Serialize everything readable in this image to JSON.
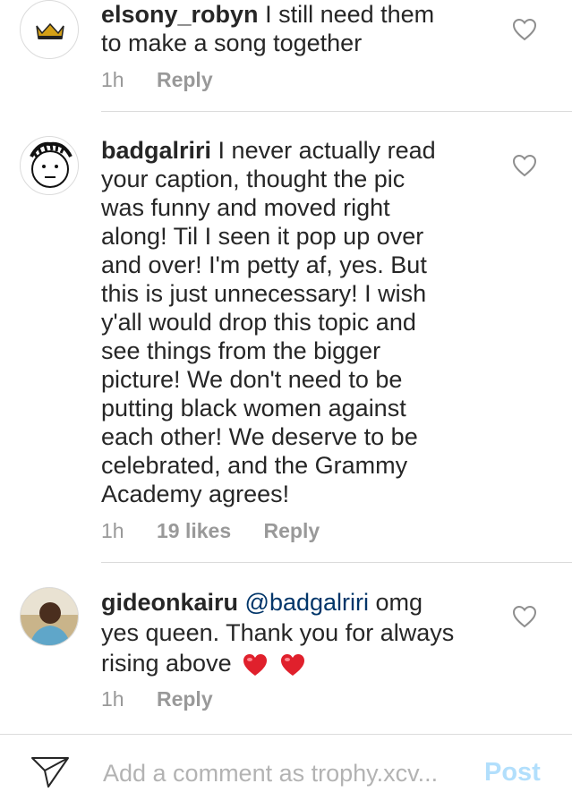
{
  "comments": [
    {
      "username": "elsony_robyn",
      "mention": "",
      "text": "I still need them to make a song together",
      "text_lines": [
        "I still need them",
        "to make a song together"
      ],
      "time": "1h",
      "likes": "",
      "reply_label": "Reply"
    },
    {
      "username": "badgalriri",
      "mention": "",
      "text_lines": [
        "I never actually read",
        "your caption, thought the pic",
        "was funny and moved right",
        "along! Til I seen it pop up over",
        "and over! I'm petty af, yes. But",
        "this is just unnecessary! I wish",
        "y'all would drop this topic and",
        "see things from the bigger",
        "picture! We don't need to be",
        "putting black women against",
        "each other! We deserve to be",
        "celebrated, and the Grammy",
        "Academy agrees!"
      ],
      "time": "1h",
      "likes": "19 likes",
      "reply_label": "Reply"
    },
    {
      "username": "gideonkairu",
      "mention": "@badgalriri",
      "text_lines": [
        "omg",
        "yes queen. Thank you for always",
        "rising above"
      ],
      "emoji": "❤️❤️",
      "time": "1h",
      "likes": "",
      "reply_label": "Reply"
    }
  ],
  "footer": {
    "placeholder": "Add a comment as trophy.xcv...",
    "post_label": "Post"
  },
  "colors": {
    "text": "#262626",
    "meta": "#999999",
    "mention": "#003569",
    "post": "#b2dffc",
    "divider": "#dbdbdb",
    "heart_emoji": "#e0202c"
  }
}
